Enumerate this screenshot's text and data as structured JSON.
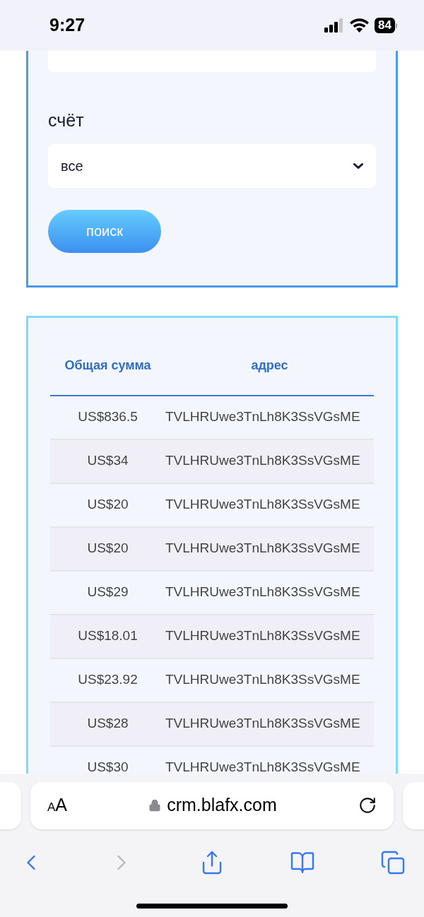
{
  "status_bar": {
    "time": "9:27",
    "battery": "84"
  },
  "filters": [
    {
      "label": "счёт",
      "value": "все"
    }
  ],
  "search_button": "поиск",
  "table": {
    "columns": [
      "Общая сумма",
      "адрес"
    ],
    "rows": [
      {
        "amount": "US$836.5",
        "address": "TVLHRUwe3TnLh8K3SsVGsME"
      },
      {
        "amount": "US$34",
        "address": "TVLHRUwe3TnLh8K3SsVGsME"
      },
      {
        "amount": "US$20",
        "address": "TVLHRUwe3TnLh8K3SsVGsME"
      },
      {
        "amount": "US$20",
        "address": "TVLHRUwe3TnLh8K3SsVGsME"
      },
      {
        "amount": "US$29",
        "address": "TVLHRUwe3TnLh8K3SsVGsME"
      },
      {
        "amount": "US$18.01",
        "address": "TVLHRUwe3TnLh8K3SsVGsME"
      },
      {
        "amount": "US$23.92",
        "address": "TVLHRUwe3TnLh8K3SsVGsME"
      },
      {
        "amount": "US$28",
        "address": "TVLHRUwe3TnLh8K3SsVGsME"
      },
      {
        "amount": "US$30",
        "address": "TVLHRUwe3TnLh8K3SsVGsME"
      }
    ]
  },
  "browser": {
    "text_size": "AA",
    "url": "crm.blafx.com",
    "nav": [
      {
        "kind": "back",
        "disabled": false
      },
      {
        "kind": "forward",
        "disabled": true
      },
      {
        "kind": "share",
        "disabled": false
      },
      {
        "kind": "bookmarks",
        "disabled": false
      },
      {
        "kind": "tabs",
        "disabled": false
      }
    ]
  }
}
